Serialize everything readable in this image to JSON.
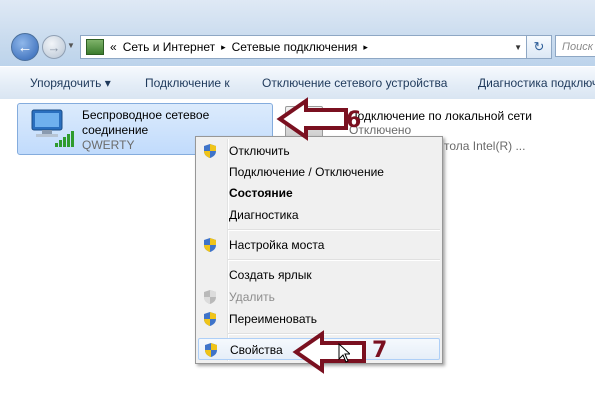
{
  "address_bar": {
    "breadcrumb": [
      "Сеть и Интернет",
      "Сетевые подключения"
    ],
    "separator": "▸",
    "overflow": "«",
    "search_placeholder": "Поиск"
  },
  "toolbar": {
    "items": [
      "Упорядочить ▾",
      "Подключение к",
      "Отключение сетевого устройства",
      "Диагностика подключ"
    ]
  },
  "connections": {
    "wireless": {
      "name_line1": "Беспроводное сетевое",
      "name_line2": "соединение",
      "ssid": "QWERTY"
    },
    "lan": {
      "name": "Подключение по локальной сети",
      "status": "Отключено",
      "adapter": "тола Intel(R) ..."
    }
  },
  "context_menu": {
    "items": [
      {
        "label": "Отключить",
        "icon": "shield-icon"
      },
      {
        "label": "Подключение / Отключение",
        "icon": ""
      },
      {
        "label": "Состояние",
        "icon": "",
        "bold": true
      },
      {
        "label": "Диагностика",
        "icon": ""
      },
      {
        "label": "Настройка моста",
        "icon": "shield-icon"
      },
      {
        "label": "Создать ярлык",
        "icon": ""
      },
      {
        "label": "Удалить",
        "icon": "shield-icon",
        "disabled": true
      },
      {
        "label": "Переименовать",
        "icon": "shield-icon"
      },
      {
        "label": "Свойства",
        "icon": "shield-icon",
        "highlighted": true
      }
    ]
  },
  "annotations": {
    "step6": "6",
    "step7": "7",
    "arrow_color": "#7a1020"
  }
}
